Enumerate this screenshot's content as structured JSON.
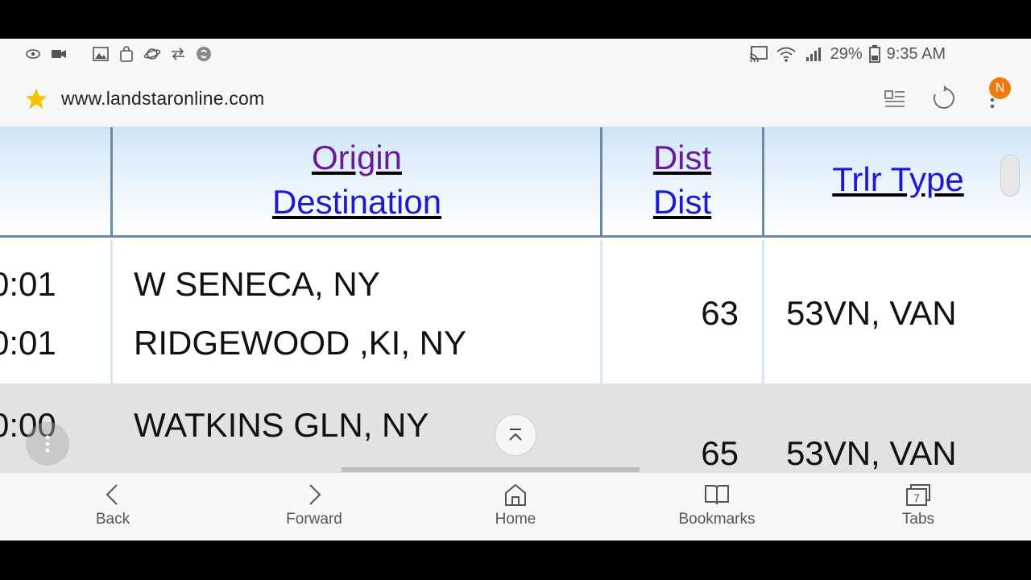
{
  "status_bar": {
    "battery": "29%",
    "time": "9:35 AM",
    "left_icons": [
      "eye-icon",
      "video-icon",
      "image-icon",
      "bag-icon",
      "planet-icon",
      "sync-icon",
      "shazam-icon"
    ],
    "right_icons": [
      "cast-icon",
      "wifi-icon",
      "signal-icon",
      "battery-icon"
    ]
  },
  "url_bar": {
    "url": "www.landstaronline.com",
    "menu_badge": "N"
  },
  "table": {
    "headers": {
      "origin": "Origin",
      "destination": "Destination",
      "dist_top": "Dist",
      "dist_bottom": "Dist",
      "trlr_type": "Trlr Type"
    },
    "rows": [
      {
        "time_top": "0:01",
        "time_bottom": "0:01",
        "origin": "W SENECA, NY",
        "destination": "RIDGEWOOD ,KI, NY",
        "dist": "63",
        "trlr": "53VN, VAN"
      },
      {
        "time_top": "0:00",
        "origin": "WATKINS GLN, NY",
        "dist": "65",
        "trlr": "53VN, VAN"
      }
    ]
  },
  "bottom_nav": {
    "back": "Back",
    "forward": "Forward",
    "home": "Home",
    "bookmarks": "Bookmarks",
    "tabs": "Tabs",
    "tabs_count": "7"
  },
  "colors": {
    "visited_link": "#6a1b9a",
    "link": "#1a1ad6",
    "badge": "#f0780f",
    "header_border": "#6b8aa6"
  }
}
